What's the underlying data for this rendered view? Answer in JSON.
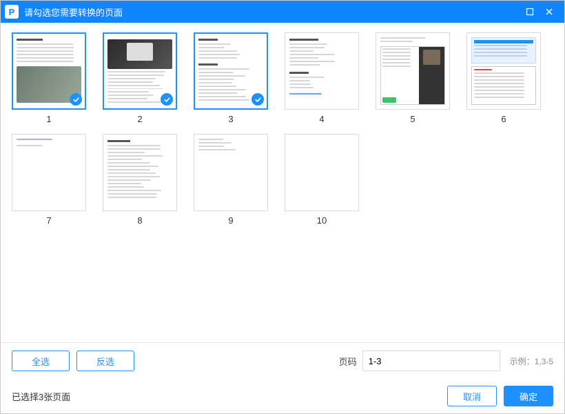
{
  "title": "请勾选您需要转换的页面",
  "pages": [
    {
      "num": "1",
      "selected": true
    },
    {
      "num": "2",
      "selected": true
    },
    {
      "num": "3",
      "selected": true
    },
    {
      "num": "4",
      "selected": false
    },
    {
      "num": "5",
      "selected": false
    },
    {
      "num": "6",
      "selected": false
    },
    {
      "num": "7",
      "selected": false
    },
    {
      "num": "8",
      "selected": false
    },
    {
      "num": "9",
      "selected": false
    },
    {
      "num": "10",
      "selected": false
    }
  ],
  "buttons": {
    "select_all": "全选",
    "invert": "反选",
    "cancel": "取消",
    "ok": "确定"
  },
  "pagerange": {
    "label": "页码",
    "value": "1-3",
    "example": "示例：1,3-5"
  },
  "status": "已选择3张页面"
}
